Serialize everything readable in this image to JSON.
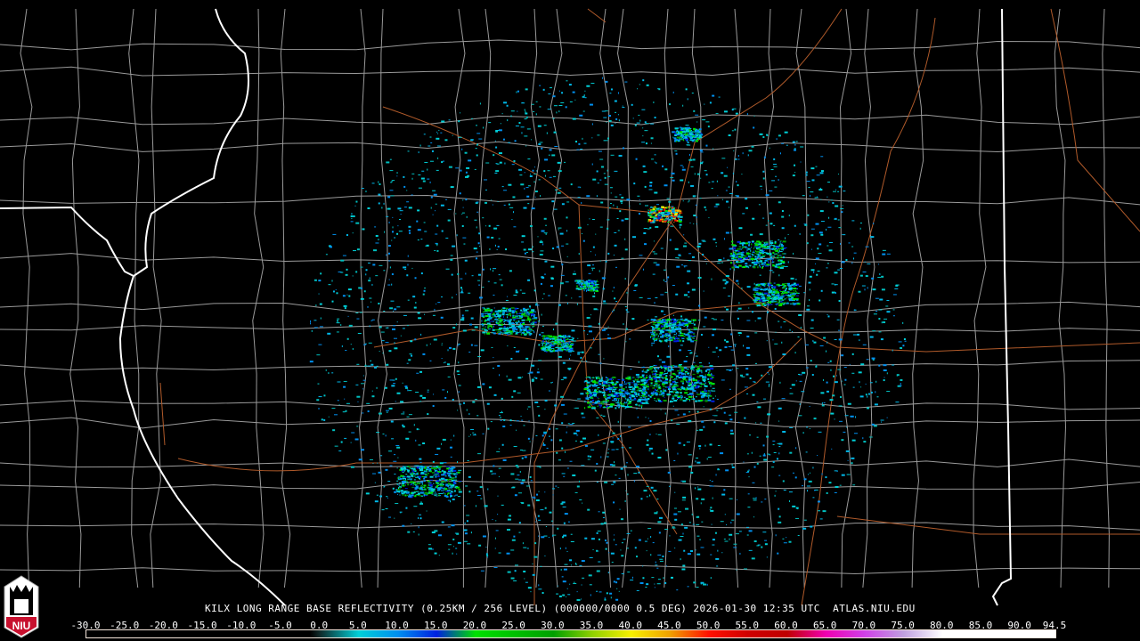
{
  "product": {
    "title": "KILX LONG RANGE BASE REFLECTIVITY (0.25KM / 256 LEVEL) (000000/0000 0.5 DEG) 2026-01-30 12:35 UTC  ATLAS.NIU.EDU",
    "radar": "KILX",
    "timestamp": "2026-01-30 12:35 UTC",
    "source": "ATLAS.NIU.EDU"
  },
  "logo": {
    "text": "NIU"
  },
  "colorbar": {
    "labels": [
      "-30.0",
      "-25.0",
      "-20.0",
      "-15.0",
      "-10.0",
      "-5.0",
      "0.0",
      "5.0",
      "10.0",
      "15.0",
      "20.0",
      "25.0",
      "30.0",
      "35.0",
      "40.0",
      "45.0",
      "50.0",
      "55.0",
      "60.0",
      "65.0",
      "70.0",
      "75.0",
      "80.0",
      "85.0",
      "90.0",
      "94.5"
    ],
    "min": -30,
    "max": 94.5,
    "colors": {
      "0": "#0f2a2a",
      "5": "#00d0d8",
      "10": "#0090f0",
      "15": "#0020e0",
      "20": "#00e000",
      "30": "#00a000",
      "35": "#90d000",
      "40": "#f8f000",
      "45": "#f0a000",
      "50": "#ff1000",
      "55": "#d00000",
      "60": "#c00000",
      "65": "#f000b0",
      "70": "#d040e8",
      "75": "#c0a0e0",
      "80": "#ffffff"
    }
  },
  "colors": {
    "state_border": "#ffffff",
    "county": "#9a9a9a",
    "highway": "#b05a2a",
    "background": "#000000"
  }
}
